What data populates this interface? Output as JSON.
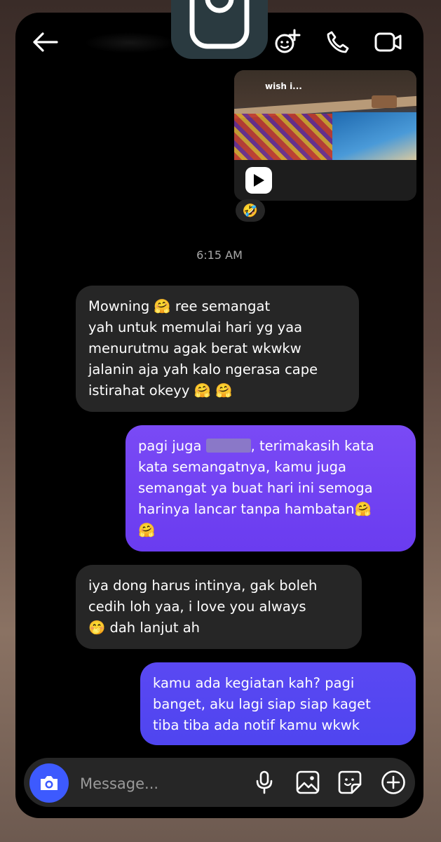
{
  "header": {
    "back_icon": "arrow-left-icon",
    "actions": [
      "add-people-icon",
      "phone-icon",
      "video-icon"
    ]
  },
  "shared_reel": {
    "caption": "wish i...",
    "reaction": "🤣"
  },
  "timestamp": "6:15 AM",
  "messages": [
    {
      "direction": "received",
      "text": "Mowning 🤗 ree semangat\nyah untuk memulai hari yg yaa\nmenurutmu agak berat wkwkw\njalanin aja yah kalo ngerasa cape\nistirahat okeyy 🤗 🤗"
    },
    {
      "direction": "sent",
      "text_before": "pagi juga ",
      "text_after": ", terimakasih kata\nkata semangatnya, kamu juga\nsemangat ya buat hari ini semoga\nharinya lancar tanpa hambatan🤗\n🤗"
    },
    {
      "direction": "received",
      "text": "iya dong harus intinya, gak boleh\ncedih loh yaa, i love you always\n🤭 dah lanjut ah"
    },
    {
      "direction": "sent",
      "text": "kamu ada kegiatan kah? pagi\nbanget, aku lagi siap siap kaget\ntiba tiba ada notif kamu wkwk"
    }
  ],
  "composer": {
    "placeholder": "Message...",
    "icons": [
      "camera-icon",
      "microphone-icon",
      "gallery-icon",
      "sticker-icon",
      "plus-icon"
    ]
  },
  "colors": {
    "sent_bubble": "#6a3cf0",
    "received_bubble": "#262626",
    "camera_button": "#3d5afe"
  }
}
